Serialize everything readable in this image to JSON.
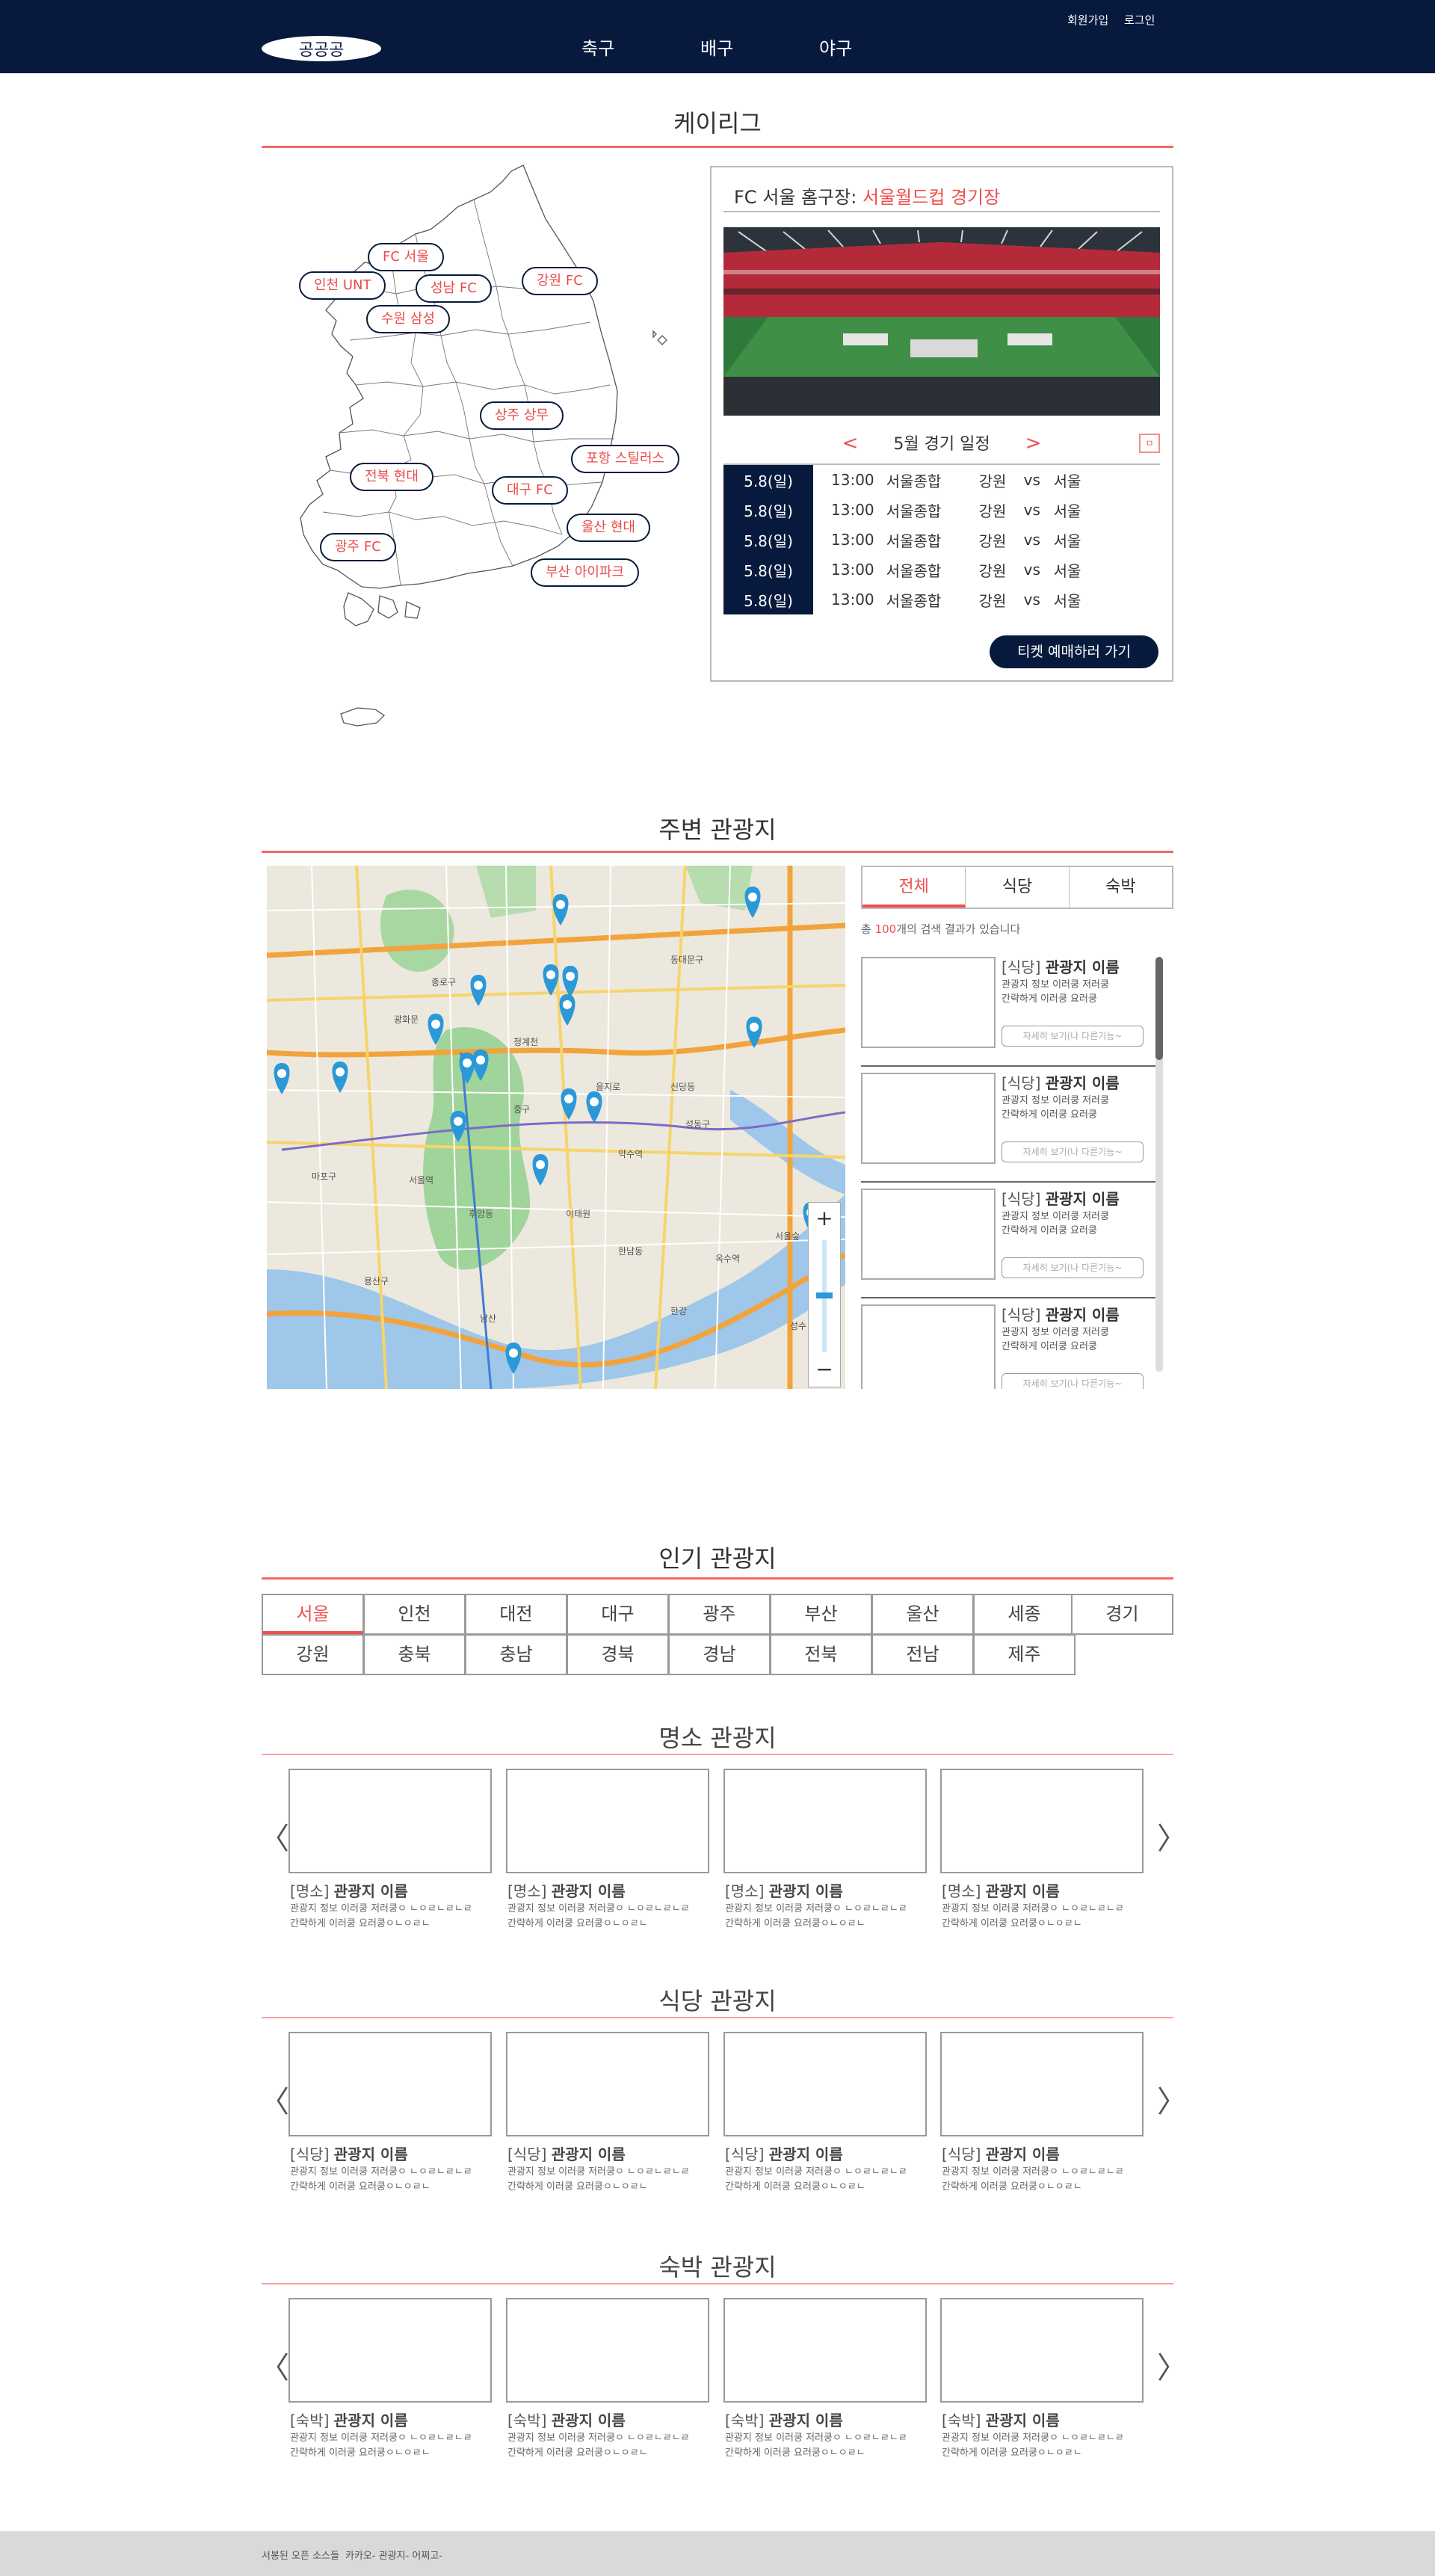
{
  "header": {
    "logo": "공공공",
    "nav": [
      "축구",
      "배구",
      "야구"
    ],
    "util": {
      "signup": "회원가입",
      "login": "로그인"
    }
  },
  "league": {
    "title": "케이리그",
    "teams": [
      "FC 서울",
      "인천 UNT",
      "성남 FC",
      "수원 삼성",
      "강원 FC",
      "상주 상무",
      "포항 스틸러스",
      "전북 현대",
      "대구 FC",
      "울산 현대",
      "광주 FC",
      "부산 아이파크"
    ],
    "stadium": {
      "label": "FC 서울 홈구장:",
      "name": "서울월드컵 경기장",
      "schedule_title": "5월 경기 일정",
      "prev": "<",
      "next": ">",
      "toggle": "ㅁ",
      "rows": [
        {
          "date": "5.8(일)",
          "time": "13:00",
          "venue": "서울종합",
          "home": "강원",
          "vs": "vs",
          "away": "서울"
        },
        {
          "date": "5.8(일)",
          "time": "13:00",
          "venue": "서울종합",
          "home": "강원",
          "vs": "vs",
          "away": "서울"
        },
        {
          "date": "5.8(일)",
          "time": "13:00",
          "venue": "서울종합",
          "home": "강원",
          "vs": "vs",
          "away": "서울"
        },
        {
          "date": "5.8(일)",
          "time": "13:00",
          "venue": "서울종합",
          "home": "강원",
          "vs": "vs",
          "away": "서울"
        },
        {
          "date": "5.8(일)",
          "time": "13:00",
          "venue": "서울종합",
          "home": "강원",
          "vs": "vs",
          "away": "서울"
        }
      ],
      "ticket_button": "티켓 예매하러 가기"
    }
  },
  "nearby": {
    "title": "주변 관광지",
    "tabs": [
      "전체",
      "식당",
      "숙박"
    ],
    "active_tab": "전체",
    "count_prefix": "총 ",
    "count": "100",
    "count_suffix": "개의 검색 결과가 있습니다",
    "map_labels": [
      "서울역",
      "남산",
      "용산구",
      "마포구",
      "성동구",
      "중구",
      "종로구",
      "동대문구",
      "한강",
      "이태원",
      "을지로",
      "광화문",
      "청계천",
      "신당동",
      "약수역",
      "옥수역",
      "서울숲",
      "성수",
      "한남동",
      "후암동"
    ],
    "zoom_in": "+",
    "zoom_out": "−",
    "items": [
      {
        "tag": "[식당]",
        "name": "관광지 이름",
        "desc1": "관광지 정보 이러쿵 저러쿵",
        "desc2": "간략하게 이러쿵 요러쿵",
        "more": "자세히 보기(나 다른기능~"
      },
      {
        "tag": "[식당]",
        "name": "관광지 이름",
        "desc1": "관광지 정보 이러쿵 저러쿵",
        "desc2": "간략하게 이러쿵 요러쿵",
        "more": "자세히 보기(나 다른기능~"
      },
      {
        "tag": "[식당]",
        "name": "관광지 이름",
        "desc1": "관광지 정보 이러쿵 저러쿵",
        "desc2": "간략하게 이러쿵 요러쿵",
        "more": "자세히 보기(나 다른기능~"
      },
      {
        "tag": "[식당]",
        "name": "관광지 이름",
        "desc1": "관광지 정보 이러쿵 저러쿵",
        "desc2": "간략하게 이러쿵 요러쿵",
        "more": "자세히 보기(나 다른기능~"
      }
    ]
  },
  "popular": {
    "title": "인기 관광지",
    "regions": [
      "서울",
      "인천",
      "대전",
      "대구",
      "광주",
      "부산",
      "울산",
      "세종",
      "경기",
      "강원",
      "충북",
      "충남",
      "경북",
      "경남",
      "전북",
      "전남",
      "제주"
    ],
    "active_region": "서울",
    "categories": [
      {
        "title": "명소 관광지",
        "cards": [
          {
            "tag": "[명소]",
            "name": "관광지 이름",
            "desc1": "관광지 정보 이러쿵 저러쿵ㅇ ㄴㅇㄹㄴㄹㄴㄹ",
            "desc2": "간략하게 이러쿵 요러쿵ㅇㄴㅇㄹㄴ"
          },
          {
            "tag": "[명소]",
            "name": "관광지 이름",
            "desc1": "관광지 정보 이러쿵 저러쿵ㅇ ㄴㅇㄹㄴㄹㄴㄹ",
            "desc2": "간략하게 이러쿵 요러쿵ㅇㄴㅇㄹㄴ"
          },
          {
            "tag": "[명소]",
            "name": "관광지 이름",
            "desc1": "관광지 정보 이러쿵 저러쿵ㅇ ㄴㅇㄹㄴㄹㄴㄹ",
            "desc2": "간략하게 이러쿵 요러쿵ㅇㄴㅇㄹㄴ"
          },
          {
            "tag": "[명소]",
            "name": "관광지 이름",
            "desc1": "관광지 정보 이러쿵 저러쿵ㅇ ㄴㅇㄹㄴㄹㄴㄹ",
            "desc2": "간략하게 이러쿵 요러쿵ㅇㄴㅇㄹㄴ"
          }
        ]
      },
      {
        "title": "식당 관광지",
        "cards": [
          {
            "tag": "[식당]",
            "name": "관광지 이름",
            "desc1": "관광지 정보 이러쿵 저러쿵ㅇ ㄴㅇㄹㄴㄹㄴㄹ",
            "desc2": "간략하게 이러쿵 요러쿵ㅇㄴㅇㄹㄴ"
          },
          {
            "tag": "[식당]",
            "name": "관광지 이름",
            "desc1": "관광지 정보 이러쿵 저러쿵ㅇ ㄴㅇㄹㄴㄹㄴㄹ",
            "desc2": "간략하게 이러쿵 요러쿵ㅇㄴㅇㄹㄴ"
          },
          {
            "tag": "[식당]",
            "name": "관광지 이름",
            "desc1": "관광지 정보 이러쿵 저러쿵ㅇ ㄴㅇㄹㄴㄹㄴㄹ",
            "desc2": "간략하게 이러쿵 요러쿵ㅇㄴㅇㄹㄴ"
          },
          {
            "tag": "[식당]",
            "name": "관광지 이름",
            "desc1": "관광지 정보 이러쿵 저러쿵ㅇ ㄴㅇㄹㄴㄹㄴㄹ",
            "desc2": "간략하게 이러쿵 요러쿵ㅇㄴㅇㄹㄴ"
          }
        ]
      },
      {
        "title": "숙박 관광지",
        "cards": [
          {
            "tag": "[숙박]",
            "name": "관광지 이름",
            "desc1": "관광지 정보 이러쿵 저러쿵ㅇ ㄴㅇㄹㄴㄹㄴㄹ",
            "desc2": "간략하게 이러쿵 요러쿵ㅇㄴㅇㄹㄴ"
          },
          {
            "tag": "[숙박]",
            "name": "관광지 이름",
            "desc1": "관광지 정보 이러쿵 저러쿵ㅇ ㄴㅇㄹㄴㄹㄴㄹ",
            "desc2": "간략하게 이러쿵 요러쿵ㅇㄴㅇㄹㄴ"
          },
          {
            "tag": "[숙박]",
            "name": "관광지 이름",
            "desc1": "관광지 정보 이러쿵 저러쿵ㅇ ㄴㅇㄹㄴㄹㄴㄹ",
            "desc2": "간략하게 이러쿵 요러쿵ㅇㄴㅇㄹㄴ"
          },
          {
            "tag": "[숙박]",
            "name": "관광지 이름",
            "desc1": "관광지 정보 이러쿵 저러쿵ㅇ ㄴㅇㄹㄴㄹㄴㄹ",
            "desc2": "간략하게 이러쿵 요러쿵ㅇㄴㅇㄹㄴ"
          }
        ]
      }
    ],
    "prev_arrow": "〈",
    "next_arrow": "〉"
  },
  "footer": {
    "left": "서봉된 오픈 소스들",
    "right": "카카오- 관광지- 어쩌고-"
  },
  "colors": {
    "navy": "#071a3e",
    "accent": "#ef4f4f"
  }
}
